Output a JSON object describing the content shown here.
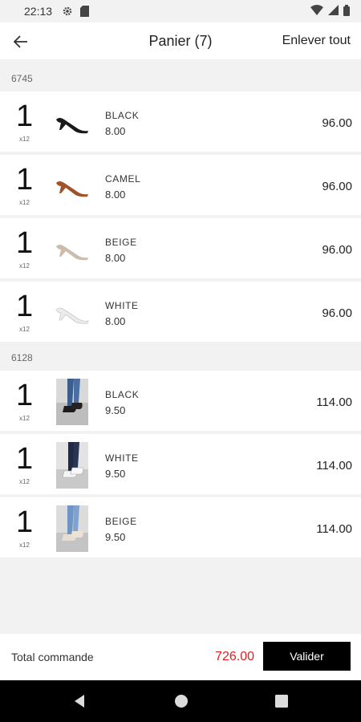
{
  "status_bar": {
    "time": "22:13"
  },
  "app_bar": {
    "title": "Panier (7)",
    "clear_label": "Enlever tout"
  },
  "groups": [
    {
      "code": "6745",
      "items": [
        {
          "qty": "1",
          "qty_unit": "x12",
          "name": "BLACK",
          "unit_price": "8.00",
          "line_total": "96.00",
          "thumb": "pump-black-icon"
        },
        {
          "qty": "1",
          "qty_unit": "x12",
          "name": "CAMEL",
          "unit_price": "8.00",
          "line_total": "96.00",
          "thumb": "pump-camel-icon"
        },
        {
          "qty": "1",
          "qty_unit": "x12",
          "name": "BEIGE",
          "unit_price": "8.00",
          "line_total": "96.00",
          "thumb": "pump-beige-icon"
        },
        {
          "qty": "1",
          "qty_unit": "x12",
          "name": "WHITE",
          "unit_price": "8.00",
          "line_total": "96.00",
          "thumb": "pump-white-icon"
        }
      ]
    },
    {
      "code": "6128",
      "items": [
        {
          "qty": "1",
          "qty_unit": "x12",
          "name": "BLACK",
          "unit_price": "9.50",
          "line_total": "114.00",
          "thumb": "sneaker-photo-black"
        },
        {
          "qty": "1",
          "qty_unit": "x12",
          "name": "WHITE",
          "unit_price": "9.50",
          "line_total": "114.00",
          "thumb": "sneaker-photo-white"
        },
        {
          "qty": "1",
          "qty_unit": "x12",
          "name": "BEIGE",
          "unit_price": "9.50",
          "line_total": "114.00",
          "thumb": "sneaker-photo-beige"
        }
      ]
    }
  ],
  "footer": {
    "total_label": "Total commande",
    "total_value": "726.00",
    "validate_label": "Valider"
  },
  "colors": {
    "accent_total": "#e02020",
    "button_bg": "#000000",
    "background": "#f2f2f2"
  }
}
